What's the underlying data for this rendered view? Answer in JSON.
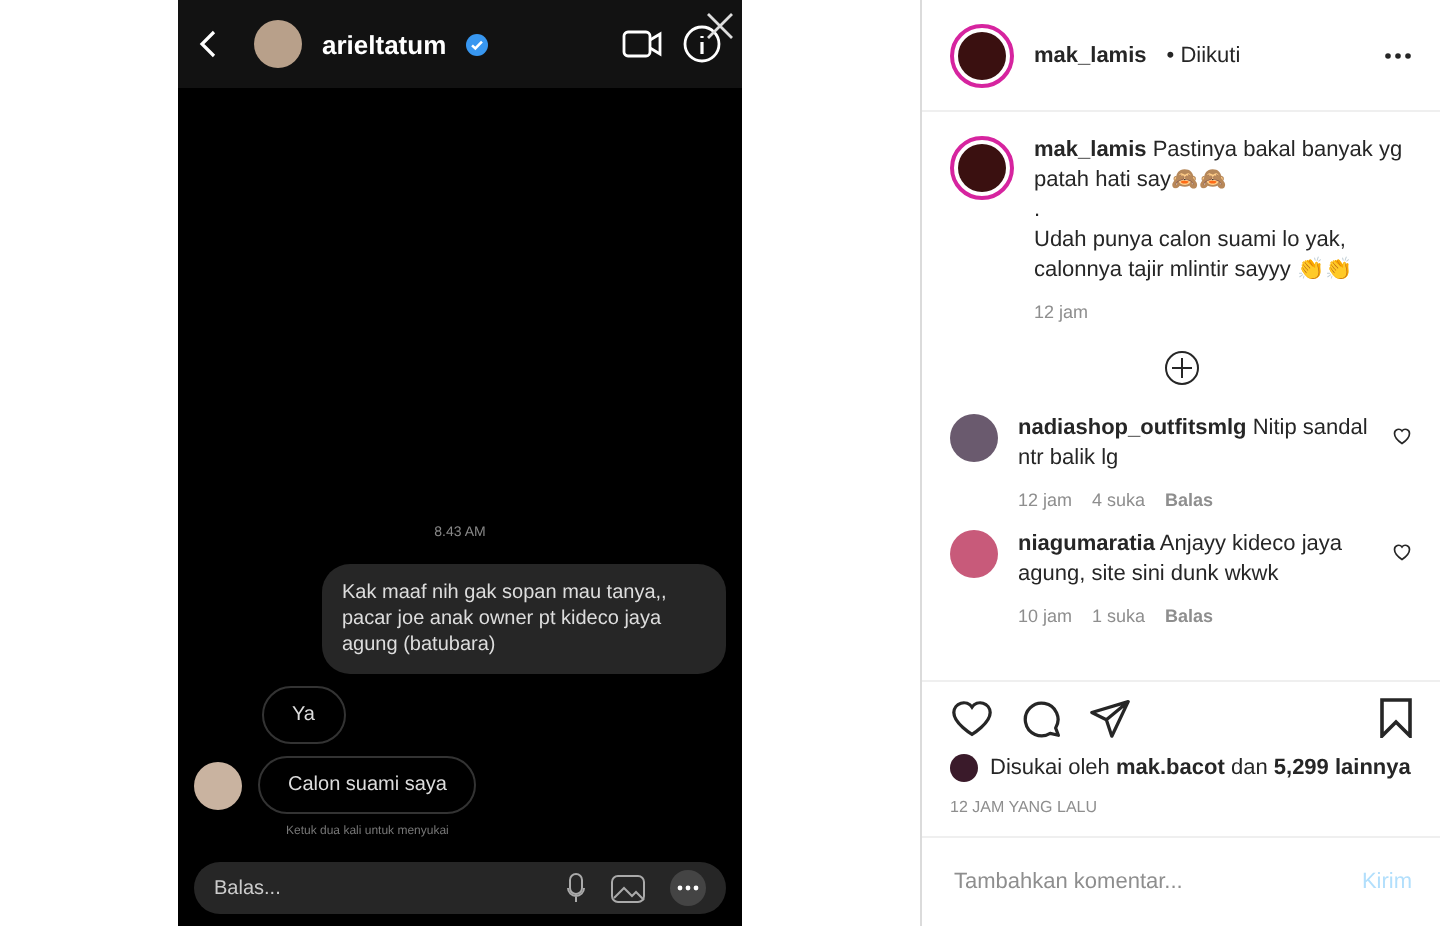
{
  "chat": {
    "username": "arieltatum",
    "verified": true,
    "time": "8.43 AM",
    "messages": [
      {
        "text": "Kak maaf nih gak sopan mau tanya,, pacar joe anak owner pt kideco jaya agung (batubara)",
        "kind": "sent"
      },
      {
        "text": "Ya",
        "kind": "received"
      },
      {
        "text": "Calon suami saya",
        "kind": "received"
      }
    ],
    "hint": "Ketuk dua kali untuk menyukai",
    "reply_placeholder": "Balas..."
  },
  "post": {
    "username": "mak_lamis",
    "separator": "•",
    "follow_status": "Diikuti",
    "caption": {
      "username": "mak_lamis",
      "lines": [
        "Pastinya bakal banyak yg patah hati say🙈🙈",
        ".",
        "Udah punya calon suami lo yak, calonnya tajir mlintir sayyy 👏👏"
      ],
      "time": "12 jam"
    },
    "comments": [
      {
        "username": "nadiashop_outfitsmlg",
        "text": "Nitip sandal ntr balik lg",
        "time": "12 jam",
        "likes": "4 suka",
        "reply": "Balas",
        "liked": false
      },
      {
        "username": "niagumaratia",
        "text": "Anjayy kideco jaya agung, site sini dunk wkwk",
        "time": "10 jam",
        "likes": "1 suka",
        "reply": "Balas",
        "liked": false
      }
    ],
    "liked_by": {
      "prefix": "Disukai oleh",
      "user": "mak.bacot",
      "middle": "dan",
      "count": "5,299 lainnya"
    },
    "posted": "12 JAM YANG LALU",
    "comment_placeholder": "Tambahkan komentar...",
    "submit": "Kirim"
  }
}
